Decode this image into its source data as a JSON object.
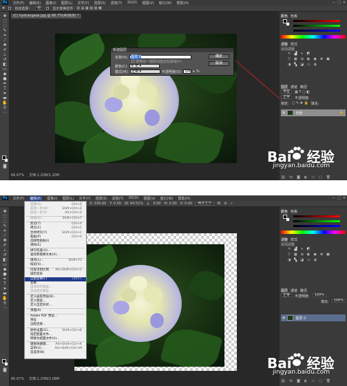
{
  "menubar": {
    "logo": "Ps",
    "items": [
      "文件(F)",
      "编辑(E)",
      "图像(I)",
      "图层(L)",
      "文字(Y)",
      "选择(S)",
      "滤镜(T)",
      "3D(D)",
      "视图(V)",
      "窗口(W)",
      "帮助(H)"
    ]
  },
  "window_buttons": [
    "—",
    "□",
    "✕"
  ],
  "top": {
    "options": {
      "auto_select": "自动选择：",
      "group": "组",
      "show_transform": "显示变换控件"
    },
    "doc_tab": "(C) hydrangeas.jpg @ 66.7%(RGB/8) *",
    "zoom": "66.67%",
    "doc_size": "文档:1.20M/1.20M",
    "dialog": {
      "title": "新建图层",
      "name_label": "名称(N):",
      "name_value": "图层 0",
      "clip_label": "使用前一图层创建剪贴蒙版(P)",
      "color_label": "颜色(C):",
      "color_value": "无",
      "mode_label": "模式(M):",
      "mode_value": "正常",
      "opacity_label": "不透明度(O):",
      "opacity_value": "100",
      "opacity_unit": "%",
      "ok": "确定",
      "cancel": "取消"
    },
    "panels": {
      "color_tabs": [
        "颜色",
        "色板"
      ],
      "adjust_tabs": [
        "调整",
        "样式"
      ],
      "adjust_title": "添加调整",
      "layer_tabs": [
        "图层",
        "通道",
        "路径"
      ],
      "kind": "类型",
      "blend": "正常",
      "opacity": "不透明度:",
      "lock": "锁定:",
      "fill": "填充:",
      "layer_name": "背景"
    }
  },
  "bottom": {
    "options": {
      "x": "X: 534.00",
      "y": "Y: 0.00",
      "w": "W: 94.51%",
      "angle": "0.00",
      "h": "H: 0.00",
      "v": "V: 0.00",
      "interp": "两次立方"
    },
    "zoom": "66.67%",
    "doc_size": "文档:1.20M/2.08M",
    "edit_menu": [
      {
        "label": "还原(O)",
        "sc": "Ctrl+Z",
        "state": "dis"
      },
      {
        "label": "前进一步(W)",
        "sc": "Shift+Ctrl+Z",
        "state": "dis"
      },
      {
        "label": "后退一步(K)",
        "sc": "Alt+Ctrl+Z",
        "state": "dis"
      },
      {
        "sep": true
      },
      {
        "label": "渐隐(D)...",
        "sc": "Shift+Ctrl+F",
        "state": "dis"
      },
      {
        "sep": true
      },
      {
        "label": "剪切(T)",
        "sc": "Ctrl+X",
        "state": ""
      },
      {
        "label": "拷贝(C)",
        "sc": "Ctrl+C",
        "state": ""
      },
      {
        "label": "合并拷贝(Y)",
        "sc": "Shift+Ctrl+C",
        "state": ""
      },
      {
        "label": "粘贴(P)",
        "sc": "Ctrl+V",
        "state": ""
      },
      {
        "label": "选择性粘贴(I)",
        "sc": "",
        "state": ""
      },
      {
        "label": "清除(E)",
        "sc": "",
        "state": ""
      },
      {
        "sep": true
      },
      {
        "label": "拼写检查(H)...",
        "sc": "",
        "state": ""
      },
      {
        "label": "查找和替换文本(X)...",
        "sc": "",
        "state": ""
      },
      {
        "sep": true
      },
      {
        "label": "填充(L)...",
        "sc": "Shift+F5",
        "state": ""
      },
      {
        "label": "描边(S)...",
        "sc": "",
        "state": ""
      },
      {
        "sep": true
      },
      {
        "label": "内容识别比例",
        "sc": "Alt+Shift+Ctrl+C",
        "state": ""
      },
      {
        "label": "操控变形",
        "sc": "",
        "state": ""
      },
      {
        "label": "自由变换(F)",
        "sc": "Ctrl+T",
        "state": "hl"
      },
      {
        "label": "变换",
        "sc": "",
        "state": ""
      },
      {
        "label": "自动对齐图层...",
        "sc": "",
        "state": "dis"
      },
      {
        "label": "自动混合图层...",
        "sc": "",
        "state": "dis"
      },
      {
        "sep": true
      },
      {
        "label": "定义画笔预设(B)...",
        "sc": "",
        "state": ""
      },
      {
        "label": "定义图案...",
        "sc": "",
        "state": ""
      },
      {
        "label": "定义自定形状...",
        "sc": "",
        "state": ""
      },
      {
        "sep": true
      },
      {
        "label": "清理(R)",
        "sc": "",
        "state": ""
      },
      {
        "sep": true
      },
      {
        "label": "Adobe PDF 预设...",
        "sc": "",
        "state": ""
      },
      {
        "label": "预设",
        "sc": "",
        "state": ""
      },
      {
        "label": "远程连接...",
        "sc": "",
        "state": ""
      },
      {
        "sep": true
      },
      {
        "label": "颜色设置(G)...",
        "sc": "Shift+Ctrl+K",
        "state": ""
      },
      {
        "label": "指定配置文件...",
        "sc": "",
        "state": ""
      },
      {
        "label": "转换为配置文件(V)...",
        "sc": "",
        "state": ""
      },
      {
        "sep": true
      },
      {
        "label": "键盘快捷键...",
        "sc": "Alt+Shift+Ctrl+K",
        "state": ""
      },
      {
        "label": "菜单(U)...",
        "sc": "Alt+Shift+Ctrl+M",
        "state": ""
      },
      {
        "label": "首选项(N)",
        "sc": "",
        "state": ""
      }
    ],
    "panels": {
      "color_tabs": [
        "颜色",
        "色板"
      ],
      "adjust_tabs": [
        "调整",
        "样式"
      ],
      "adjust_title": "添加调整",
      "layer_tabs": [
        "图层",
        "通道",
        "路径"
      ],
      "blend": "正常",
      "opacity": "不透明度:",
      "opacity_value": "100%",
      "fill": "填充:",
      "fill_value": "100%",
      "layer_name": "图层 0"
    }
  },
  "watermark": {
    "brand_a": "Bai",
    "brand_b": "经验",
    "url": "jingyan.baidu.com"
  },
  "colors": {
    "ui_dark": "#282828",
    "panel": "#3a3a3a",
    "highlight": "#213a8a",
    "arrow": "#d22"
  }
}
